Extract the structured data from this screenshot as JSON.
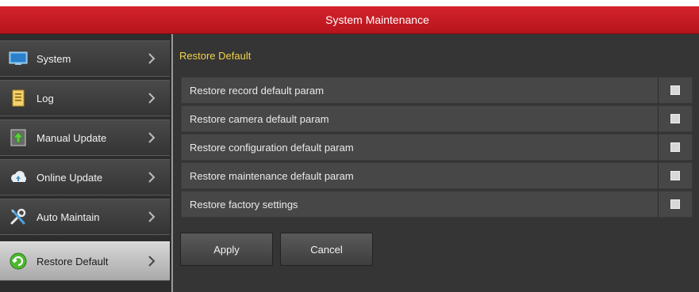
{
  "window": {
    "title": "System Maintenance"
  },
  "sidebar": {
    "items": [
      {
        "label": "System",
        "icon": "monitor-icon"
      },
      {
        "label": "Log",
        "icon": "notepad-icon"
      },
      {
        "label": "Manual Update",
        "icon": "manual-update-icon"
      },
      {
        "label": "Online Update",
        "icon": "cloud-icon"
      },
      {
        "label": "Auto Maintain",
        "icon": "tools-icon"
      },
      {
        "label": "Restore Default",
        "icon": "restore-icon",
        "active": true
      }
    ]
  },
  "main": {
    "section_title": "Restore Default",
    "options": [
      {
        "label": "Restore record default param",
        "checked": false
      },
      {
        "label": "Restore camera default param",
        "checked": false
      },
      {
        "label": "Restore configuration default param",
        "checked": false
      },
      {
        "label": "Restore maintenance default param",
        "checked": false
      },
      {
        "label": "Restore factory settings",
        "checked": false
      }
    ],
    "buttons": {
      "apply": "Apply",
      "cancel": "Cancel"
    }
  },
  "colors": {
    "titlebar": "#c41c25",
    "section_title": "#f0d24a",
    "active_item": "#c8c8c8"
  }
}
